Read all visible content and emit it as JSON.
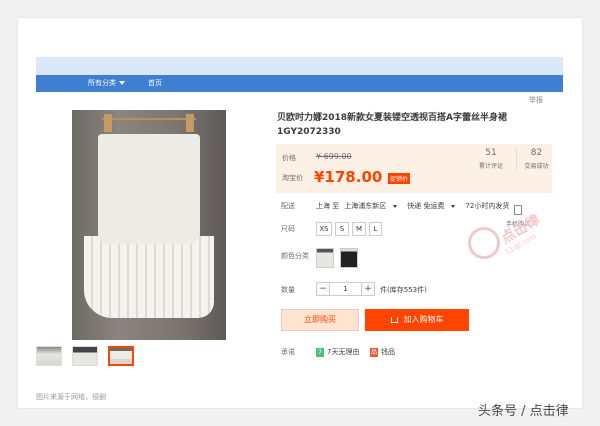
{
  "nav": {
    "all_categories": "所有分类",
    "home": "首页"
  },
  "report": "举报",
  "product": {
    "title": "贝欧时力娜2018新款女夏装镂空透视百搭A字蕾丝半身裙1GY2072330",
    "price_label": "价格",
    "original_price": "¥ 699.00",
    "taobao_price_label": "淘宝价",
    "current_price": "¥178.00",
    "promo_tag": "促销价",
    "stats": [
      {
        "value": "51",
        "label": "累计评论"
      },
      {
        "value": "82",
        "label": "交易成功"
      }
    ]
  },
  "shipping": {
    "label": "配送",
    "from": "上海 至",
    "to": "上海浦东新区",
    "method": "快递 免运费",
    "time": "72小时内发货",
    "phone_label": "手机购买"
  },
  "size": {
    "label": "尺码",
    "options": [
      "XS",
      "S",
      "M",
      "L"
    ]
  },
  "color": {
    "label": "颜色分类"
  },
  "quantity": {
    "label": "数量",
    "value": "1",
    "minus": "−",
    "plus": "+",
    "stock": "件(库存553件)"
  },
  "actions": {
    "buy_now": "立即购买",
    "add_to_cart": "加入购物车"
  },
  "promise": {
    "label": "承诺",
    "return": "7天无理由",
    "badge_return": "7",
    "invoice": "钱品",
    "badge_invoice": "品"
  },
  "source_note": "图片来源于网络，侵删",
  "watermark": {
    "text": "点击律",
    "url": "51djl.com"
  },
  "footer": "头条号 / 点击律"
}
